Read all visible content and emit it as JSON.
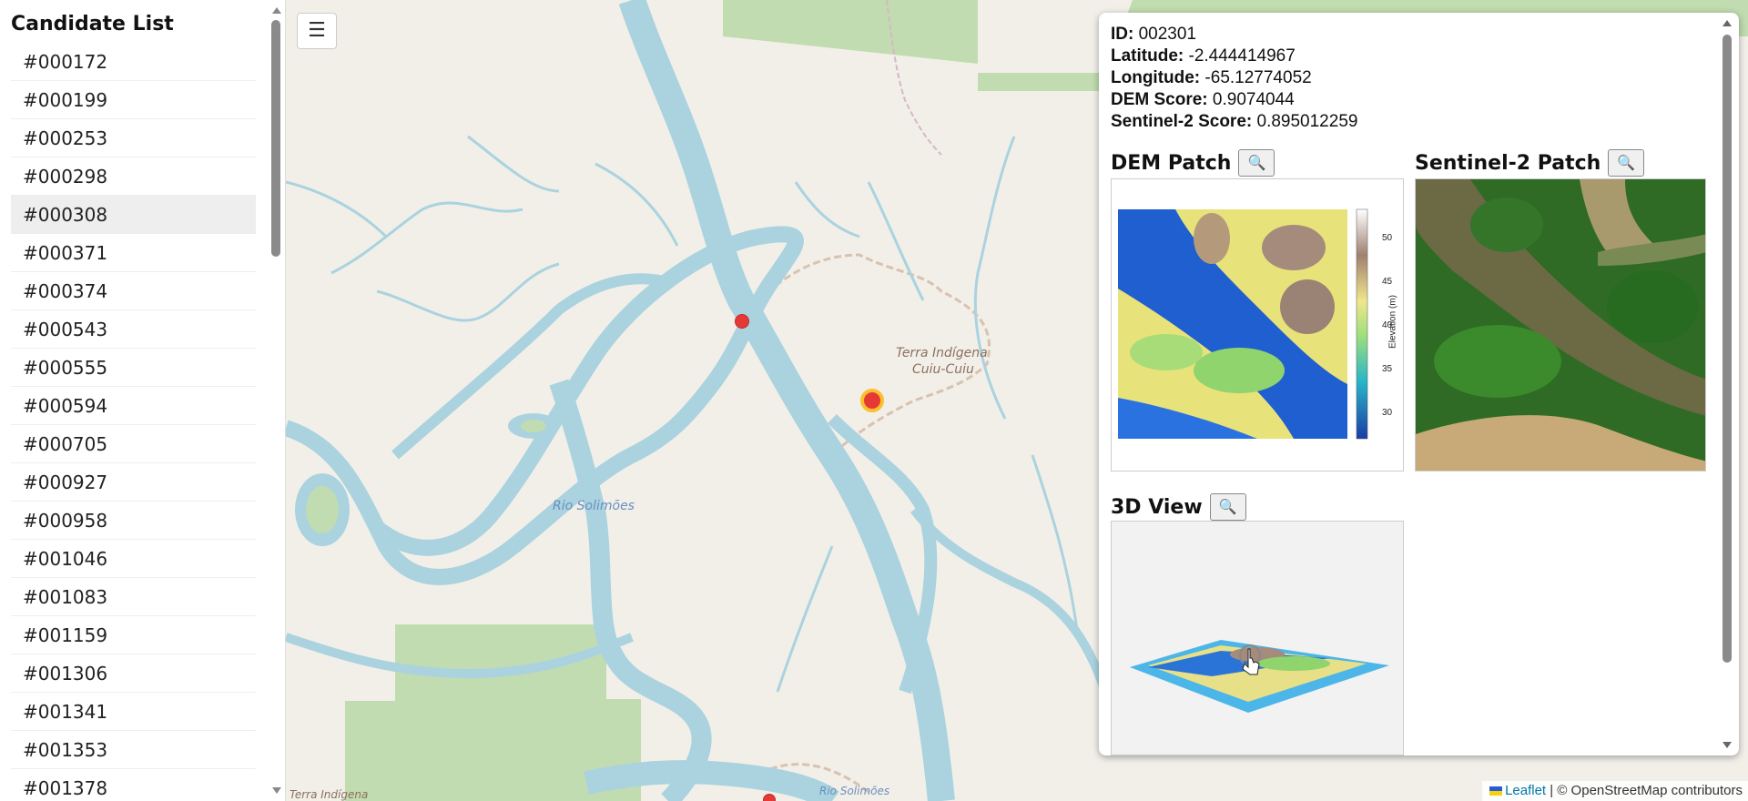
{
  "sidebar": {
    "title": "Candidate List",
    "items": [
      "#000172",
      "#000199",
      "#000253",
      "#000298",
      "#000308",
      "#000371",
      "#000374",
      "#000543",
      "#000555",
      "#000594",
      "#000705",
      "#000927",
      "#000958",
      "#001046",
      "#001083",
      "#001159",
      "#001306",
      "#001341",
      "#001353",
      "#001378"
    ],
    "selected": "#000308"
  },
  "map": {
    "menu_icon": "☰",
    "labels": {
      "rio_solimoes": "Rio Solimões",
      "rio_solimoes_bottom": "Rio Solimões",
      "terra_indigena": "Terra Indígena",
      "cuiu_cuiu": "Cuiu-Cuiu",
      "terra_indigena_bottom": "Terra Indígena"
    },
    "attribution": {
      "leaflet": "Leaflet",
      "rest": " | © OpenStreetMap contributors"
    },
    "colors": {
      "land": "#f2efe9",
      "water": "#aad3df",
      "forest": "#c1dcb0",
      "marker": "#e53935",
      "highlight": "#fbc02d"
    }
  },
  "panel": {
    "id_label": "ID:",
    "id_value": "002301",
    "lat_label": "Latitude:",
    "lat_value": "-2.444414967",
    "lon_label": "Longitude:",
    "lon_value": "-65.12774052",
    "dem_label": "DEM Score:",
    "dem_value": "0.9074044",
    "s2_label": "Sentinel-2 Score:",
    "s2_value": "0.895012259",
    "dem_patch_title": "DEM Patch",
    "s2_patch_title": "Sentinel-2 Patch",
    "view3d_title": "3D View",
    "zoom_icon": "🔍",
    "colorbar": {
      "label": "Elevation (m)",
      "ticks": [
        "50",
        "45",
        "40",
        "35",
        "30"
      ]
    }
  }
}
